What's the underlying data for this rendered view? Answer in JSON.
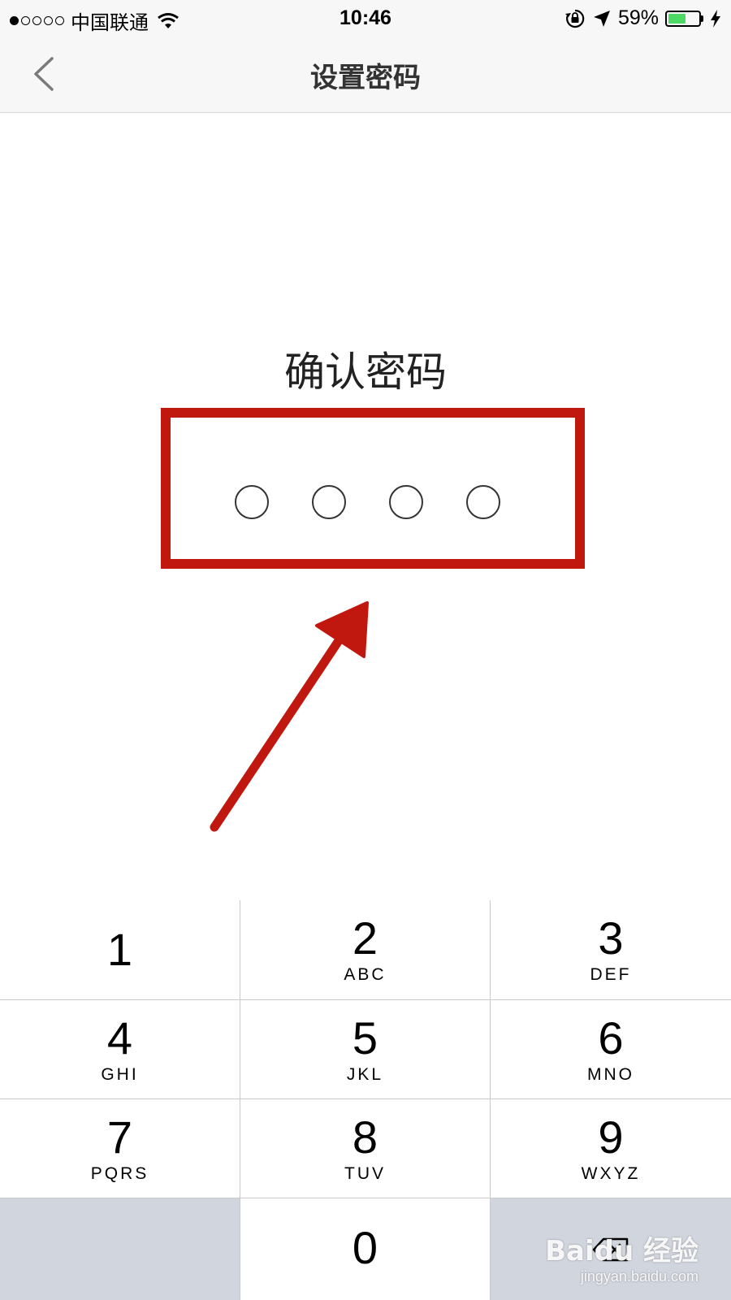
{
  "status_bar": {
    "carrier": "中国联通",
    "time": "10:46",
    "battery_percent": "59%",
    "battery_level": 0.59,
    "battery_color": "#4cd964",
    "icons": [
      "signal-dots",
      "wifi-icon",
      "orientation-lock-icon",
      "location-arrow-icon",
      "battery-icon",
      "charging-bolt-icon"
    ]
  },
  "nav": {
    "title": "设置密码",
    "back_icon": "chevron-left-icon"
  },
  "content": {
    "prompt": "确认密码",
    "pin_length": 4,
    "highlight_color": "#c0170f"
  },
  "keypad": {
    "keys": [
      {
        "num": "1",
        "letters": ""
      },
      {
        "num": "2",
        "letters": "ABC"
      },
      {
        "num": "3",
        "letters": "DEF"
      },
      {
        "num": "4",
        "letters": "GHI"
      },
      {
        "num": "5",
        "letters": "JKL"
      },
      {
        "num": "6",
        "letters": "MNO"
      },
      {
        "num": "7",
        "letters": "PQRS"
      },
      {
        "num": "8",
        "letters": "TUV"
      },
      {
        "num": "9",
        "letters": "WXYZ"
      },
      {
        "num": "0",
        "letters": ""
      }
    ],
    "delete_icon": "backspace-icon"
  },
  "watermark": {
    "main": "Baidu 经验",
    "sub": "jingyan.baidu.com"
  }
}
